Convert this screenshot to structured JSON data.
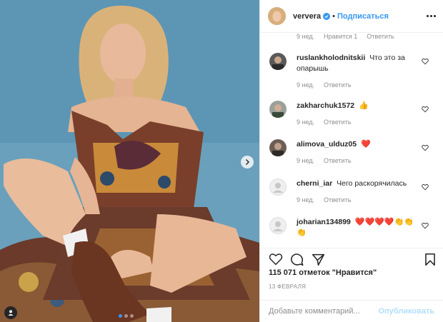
{
  "header": {
    "username": "ververa",
    "separator": "•",
    "follow_label": "Подписаться",
    "verified_icon": "verified-badge-icon",
    "more_icon": "more-options-icon"
  },
  "partial_meta": {
    "time": "9 нед.",
    "likes": "Нравится 1",
    "reply": "Ответить"
  },
  "comments": [
    {
      "user": "ruslankholodnitskii",
      "text": "Что это за опарышь",
      "time": "9 нед.",
      "reply": "Ответить"
    },
    {
      "user": "zakharchuk1572",
      "text": "👍",
      "time": "9 нед.",
      "reply": "Ответить"
    },
    {
      "user": "alimova_ulduz05",
      "text": "❤️",
      "time": "9 нед.",
      "reply": "Ответить"
    },
    {
      "user": "cherni_iar",
      "text": "Чего раскорячилась",
      "time": "9 нед.",
      "reply": "Ответить"
    },
    {
      "user": "joharian134899",
      "text": "❤️❤️❤️❤️👏👏👏",
      "time": "",
      "reply": ""
    }
  ],
  "actions": {
    "like_icon": "heart-icon",
    "comment_icon": "comment-icon",
    "share_icon": "share-icon",
    "save_icon": "bookmark-icon"
  },
  "likes": "115 071 отметок \"Нравится\"",
  "date": "13 ФЕВРАЛЯ",
  "add_comment": {
    "placeholder": "Добавьте комментарий...",
    "publish_label": "Опубликовать"
  },
  "carousel": {
    "current": 1,
    "total": 3,
    "next_icon": "chevron-right-icon",
    "tag_icon": "user-tag-icon"
  },
  "colors": {
    "accent": "#3897f0",
    "background": "#5f97b3",
    "muted": "#8e8e8e"
  }
}
